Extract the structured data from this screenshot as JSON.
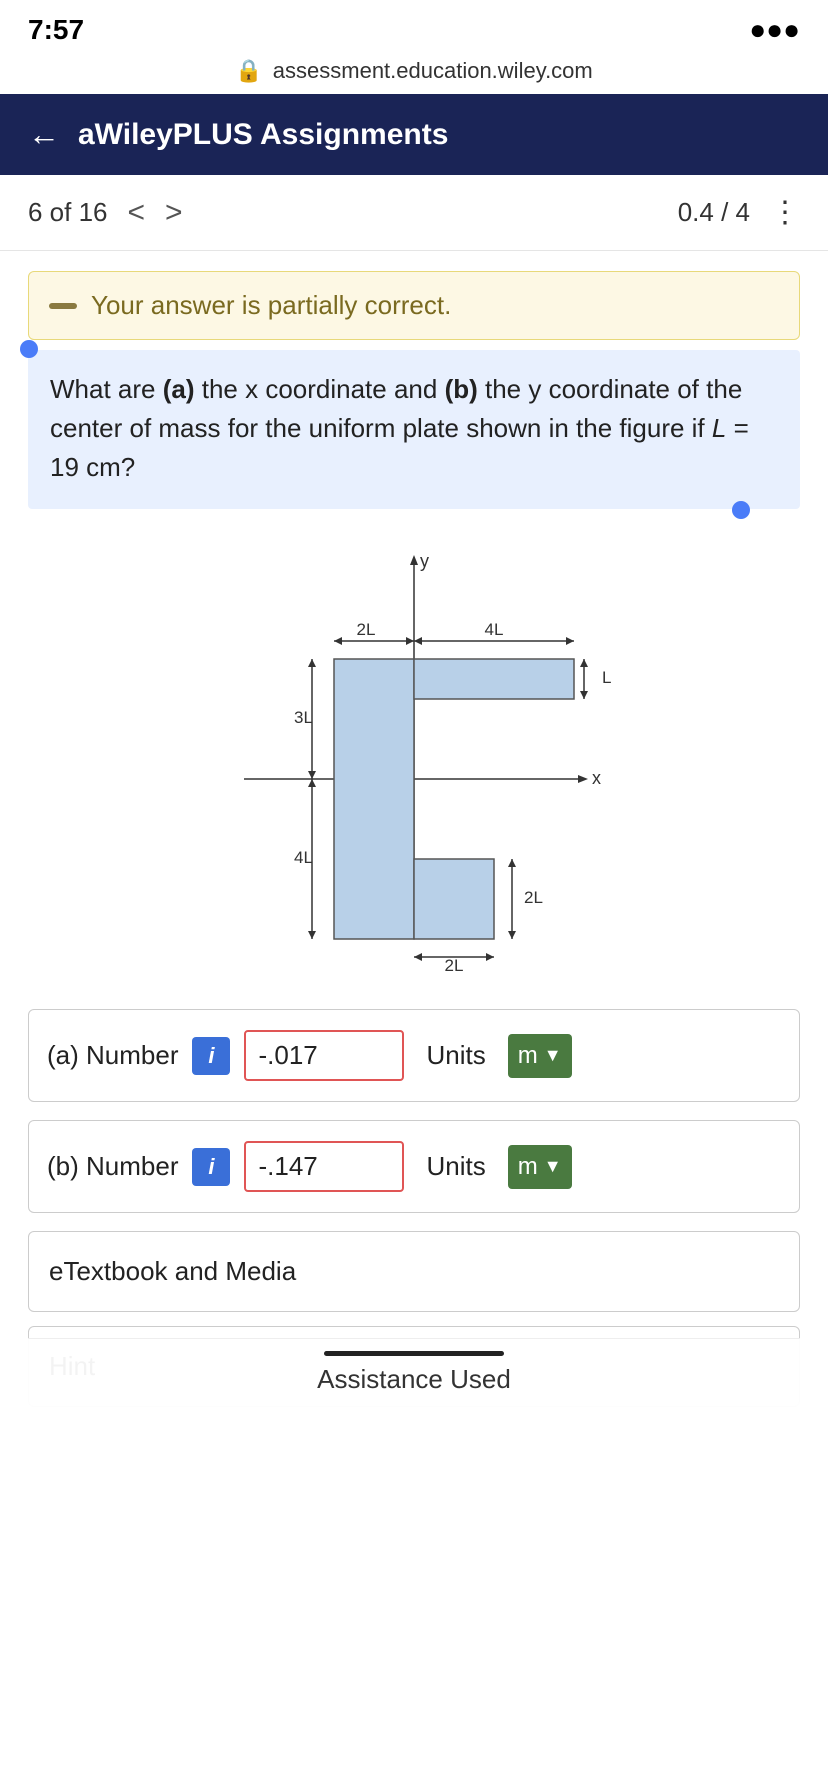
{
  "status_bar": {
    "time": "7:57",
    "signal": "●●●"
  },
  "url_bar": {
    "url": "assessment.education.wiley.com",
    "lock_icon": "🔒"
  },
  "nav_header": {
    "back_label": "←",
    "title": "aWileyPLUS Assignments"
  },
  "progress": {
    "current": "6 of 16",
    "prev_icon": "<",
    "next_icon": ">",
    "score": "0.4 / 4",
    "menu_icon": "≡"
  },
  "partial_banner": {
    "text": "Your answer is partially correct."
  },
  "question": {
    "text": "What are (a) the x coordinate and (b) the y coordinate of the center of mass for the uniform plate shown in the figure if L = 19 cm?"
  },
  "inputs": [
    {
      "id": "a",
      "label": "(a) Number",
      "info": "i",
      "value": "-.017",
      "units_label": "Units",
      "units_value": "m"
    },
    {
      "id": "b",
      "label": "(b) Number",
      "info": "i",
      "value": "-.147",
      "units_label": "Units",
      "units_value": "m"
    }
  ],
  "buttons": [
    {
      "id": "etextbook",
      "label": "eTextbook and Media"
    },
    {
      "id": "hint",
      "label": "Hint"
    }
  ],
  "assistance": {
    "text": "Assistance Used"
  }
}
